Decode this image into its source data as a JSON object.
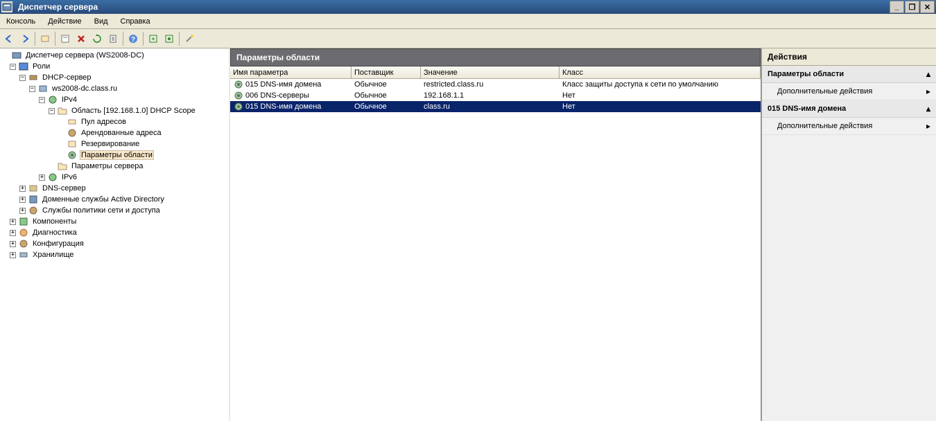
{
  "window": {
    "title": "Диспетчер сервера"
  },
  "menu": {
    "items": [
      "Консоль",
      "Действие",
      "Вид",
      "Справка"
    ]
  },
  "tree": {
    "root": "Диспетчер сервера (WS2008-DC)",
    "roles": "Роли",
    "dhcp_server": "DHCP-сервер",
    "dhcp_host": "ws2008-dc.class.ru",
    "ipv4": "IPv4",
    "scope": "Область [192.168.1.0] DHCP Scope",
    "pool": "Пул адресов",
    "leases": "Арендованные адреса",
    "reservations": "Резервирование",
    "scope_options": "Параметры области",
    "server_options": "Параметры сервера",
    "ipv6": "IPv6",
    "dns_server": "DNS-сервер",
    "adds": "Доменные службы Active Directory",
    "npas": "Службы политики сети и доступа",
    "components": "Компоненты",
    "diagnostics": "Диагностика",
    "config": "Конфигурация",
    "storage": "Хранилище"
  },
  "content": {
    "header": "Параметры области",
    "columns": [
      "Имя параметра",
      "Поставщик",
      "Значение",
      "Класс"
    ],
    "rows": [
      {
        "name": "015 DNS-имя домена",
        "vendor": "Обычное",
        "value": "restricted.class.ru",
        "class": "Класс защиты доступа к сети по умолчанию",
        "selected": false
      },
      {
        "name": "006 DNS-серверы",
        "vendor": "Обычное",
        "value": "192.168.1.1",
        "class": "Нет",
        "selected": false
      },
      {
        "name": "015 DNS-имя домена",
        "vendor": "Обычное",
        "value": "class.ru",
        "class": "Нет",
        "selected": true
      }
    ]
  },
  "actions": {
    "header": "Действия",
    "group1": "Параметры области",
    "item1": "Дополнительные действия",
    "group2": "015 DNS-имя домена",
    "item2": "Дополнительные действия"
  }
}
